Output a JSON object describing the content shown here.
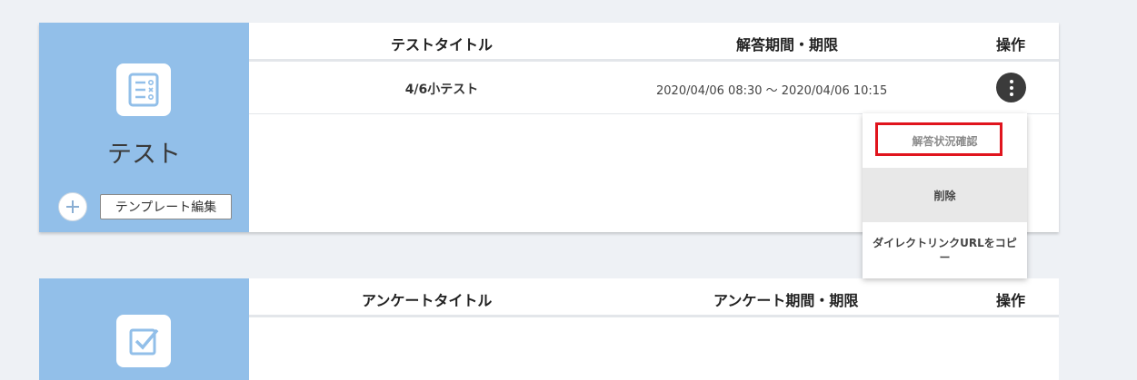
{
  "test_panel": {
    "title": "テスト",
    "icon": "test-checklist-icon",
    "template_button": "テンプレート編集",
    "columns": {
      "title": "テストタイトル",
      "period": "解答期間・期限",
      "actions": "操作"
    },
    "rows": [
      {
        "title": "4/6小テスト",
        "period": "2020/04/06 08:30 ～ 2020/04/06 10:15"
      }
    ]
  },
  "context_menu": {
    "items": [
      "解答状況確認",
      "削除",
      "ダイレクトリンクURLをコピー"
    ],
    "highlight_color": "#e0141d"
  },
  "survey_panel": {
    "icon": "survey-checkbox-icon",
    "columns": {
      "title": "アンケートタイトル",
      "period": "アンケート期間・期限",
      "actions": "操作"
    }
  },
  "colors": {
    "sidebar": "#92bfe9",
    "background": "#eef1f5",
    "action_button": "#3b3b3b"
  }
}
